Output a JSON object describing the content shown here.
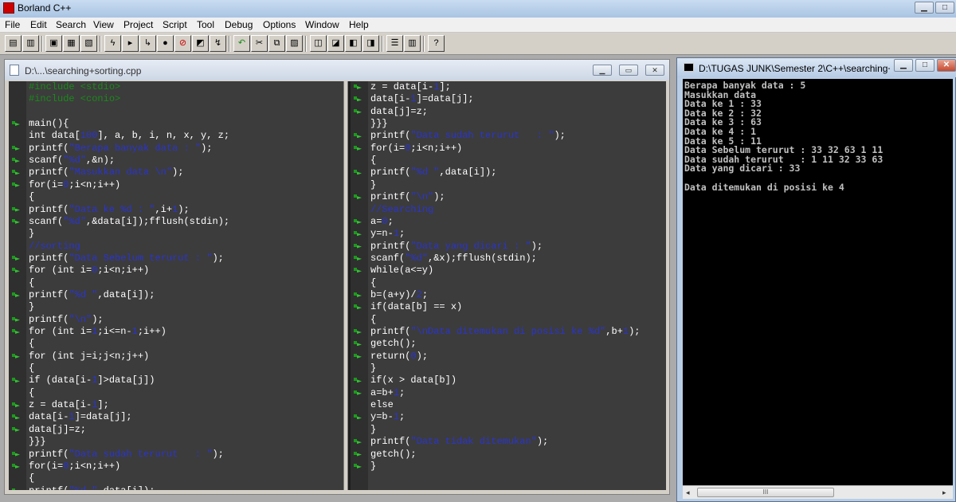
{
  "app": {
    "title": "Borland C++"
  },
  "menu": [
    "File",
    "Edit",
    "Search",
    "View",
    "Project",
    "Script",
    "Tool",
    "Debug",
    "Options",
    "Window",
    "Help"
  ],
  "editor": {
    "title": "D:\\...\\searching+sorting.cpp"
  },
  "console": {
    "title": "D:\\TUGAS JUNK\\Semester 2\\C++\\searching+...",
    "lines": [
      "Berapa banyak data : 5",
      "Masukkan data",
      "Data ke 1 : 33",
      "Data ke 2 : 32",
      "Data ke 3 : 63",
      "Data ke 4 : 1",
      "Data ke 5 : 11",
      "Data Sebelum terurut : 33 32 63 1 11",
      "Data sudah terurut   : 1 11 32 33 63",
      "Data yang dicari : 33",
      "",
      "Data ditemukan di posisi ke 4"
    ],
    "scroll_grip": "III"
  },
  "code_left": [
    {
      "m": false,
      "t": [
        [
          "p",
          "#include <stdio>"
        ]
      ]
    },
    {
      "m": false,
      "t": [
        [
          "p",
          "#include <conio>"
        ]
      ]
    },
    {
      "m": false,
      "t": []
    },
    {
      "m": true,
      "t": [
        [
          "t",
          "main(){"
        ]
      ]
    },
    {
      "m": false,
      "t": [
        [
          "t",
          "int data["
        ],
        [
          "n",
          "100"
        ],
        [
          "t",
          "], a, b, i, n, x, y, z;"
        ]
      ]
    },
    {
      "m": true,
      "t": [
        [
          "t",
          "printf("
        ],
        [
          "s",
          "\"Berapa banyak data : \""
        ],
        [
          "t",
          ");"
        ]
      ]
    },
    {
      "m": true,
      "t": [
        [
          "t",
          "scanf("
        ],
        [
          "s",
          "\"%d\""
        ],
        [
          "t",
          ",&n);"
        ]
      ]
    },
    {
      "m": true,
      "t": [
        [
          "t",
          "printf("
        ],
        [
          "s",
          "\"Masukkan data \\n\""
        ],
        [
          "t",
          ");"
        ]
      ]
    },
    {
      "m": true,
      "t": [
        [
          "t",
          "for(i="
        ],
        [
          "n",
          "0"
        ],
        [
          "t",
          ";i<n;i++)"
        ]
      ]
    },
    {
      "m": false,
      "t": [
        [
          "t",
          "{"
        ]
      ]
    },
    {
      "m": true,
      "t": [
        [
          "t",
          "printf("
        ],
        [
          "s",
          "\"Data ke %d : \""
        ],
        [
          "t",
          ",i+"
        ],
        [
          "n",
          "1"
        ],
        [
          "t",
          ");"
        ]
      ]
    },
    {
      "m": true,
      "t": [
        [
          "t",
          "scanf("
        ],
        [
          "s",
          "\"%d\""
        ],
        [
          "t",
          ",&data[i]);fflush(stdin);"
        ]
      ]
    },
    {
      "m": false,
      "t": [
        [
          "t",
          "}"
        ]
      ]
    },
    {
      "m": false,
      "t": [
        [
          "c",
          "//sorting"
        ]
      ]
    },
    {
      "m": true,
      "t": [
        [
          "t",
          "printf("
        ],
        [
          "s",
          "\"Data Sebelum terurut : \""
        ],
        [
          "t",
          ");"
        ]
      ]
    },
    {
      "m": true,
      "t": [
        [
          "t",
          "for (int i="
        ],
        [
          "n",
          "0"
        ],
        [
          "t",
          ";i<n;i++)"
        ]
      ]
    },
    {
      "m": false,
      "t": [
        [
          "t",
          "{"
        ]
      ]
    },
    {
      "m": true,
      "t": [
        [
          "t",
          "printf("
        ],
        [
          "s",
          "\"%d \""
        ],
        [
          "t",
          ",data[i]);"
        ]
      ]
    },
    {
      "m": false,
      "t": [
        [
          "t",
          "}"
        ]
      ]
    },
    {
      "m": true,
      "t": [
        [
          "t",
          "printf("
        ],
        [
          "s",
          "\"\\n\""
        ],
        [
          "t",
          ");"
        ]
      ]
    },
    {
      "m": true,
      "t": [
        [
          "t",
          "for (int i="
        ],
        [
          "n",
          "1"
        ],
        [
          "t",
          ";i<=n-"
        ],
        [
          "n",
          "1"
        ],
        [
          "t",
          ";i++)"
        ]
      ]
    },
    {
      "m": false,
      "t": [
        [
          "t",
          "{"
        ]
      ]
    },
    {
      "m": true,
      "t": [
        [
          "t",
          "for (int j=i;j<n;j++)"
        ]
      ]
    },
    {
      "m": false,
      "t": [
        [
          "t",
          "{"
        ]
      ]
    },
    {
      "m": true,
      "t": [
        [
          "t",
          "if (data[i-"
        ],
        [
          "n",
          "1"
        ],
        [
          "t",
          "]>data[j])"
        ]
      ]
    },
    {
      "m": false,
      "t": [
        [
          "t",
          "{"
        ]
      ]
    },
    {
      "m": true,
      "t": [
        [
          "t",
          "z = data[i-"
        ],
        [
          "n",
          "1"
        ],
        [
          "t",
          "];"
        ]
      ]
    },
    {
      "m": true,
      "t": [
        [
          "t",
          "data[i-"
        ],
        [
          "n",
          "1"
        ],
        [
          "t",
          "]=data[j];"
        ]
      ]
    },
    {
      "m": true,
      "t": [
        [
          "t",
          "data[j]=z;"
        ]
      ]
    },
    {
      "m": false,
      "t": [
        [
          "t",
          "}}}"
        ]
      ]
    },
    {
      "m": true,
      "t": [
        [
          "t",
          "printf("
        ],
        [
          "s",
          "\"Data sudah terurut   : \""
        ],
        [
          "t",
          ");"
        ]
      ]
    },
    {
      "m": true,
      "t": [
        [
          "t",
          "for(i="
        ],
        [
          "n",
          "0"
        ],
        [
          "t",
          ";i<n;i++)"
        ]
      ]
    },
    {
      "m": false,
      "t": [
        [
          "t",
          "{"
        ]
      ]
    },
    {
      "m": true,
      "t": [
        [
          "t",
          "printf("
        ],
        [
          "s",
          "\"%d \""
        ],
        [
          "t",
          ",data[i]);"
        ]
      ]
    }
  ],
  "code_right": [
    {
      "m": true,
      "t": [
        [
          "t",
          "z = data[i-"
        ],
        [
          "n",
          "1"
        ],
        [
          "t",
          "];"
        ]
      ]
    },
    {
      "m": true,
      "t": [
        [
          "t",
          "data[i-"
        ],
        [
          "n",
          "1"
        ],
        [
          "t",
          "]=data[j];"
        ]
      ]
    },
    {
      "m": true,
      "t": [
        [
          "t",
          "data[j]=z;"
        ]
      ]
    },
    {
      "m": false,
      "t": [
        [
          "t",
          "}}}"
        ]
      ]
    },
    {
      "m": true,
      "t": [
        [
          "t",
          "printf("
        ],
        [
          "s",
          "\"Data sudah terurut   : \""
        ],
        [
          "t",
          ");"
        ]
      ]
    },
    {
      "m": true,
      "t": [
        [
          "t",
          "for(i="
        ],
        [
          "n",
          "0"
        ],
        [
          "t",
          ";i<n;i++)"
        ]
      ]
    },
    {
      "m": false,
      "t": [
        [
          "t",
          "{"
        ]
      ]
    },
    {
      "m": true,
      "t": [
        [
          "t",
          "printf("
        ],
        [
          "s",
          "\"%d \""
        ],
        [
          "t",
          ",data[i]);"
        ]
      ]
    },
    {
      "m": false,
      "t": [
        [
          "t",
          "}"
        ]
      ]
    },
    {
      "m": true,
      "t": [
        [
          "t",
          "printf("
        ],
        [
          "s",
          "\"\\n\""
        ],
        [
          "t",
          ");"
        ]
      ]
    },
    {
      "m": false,
      "t": [
        [
          "c",
          "//Searching"
        ]
      ]
    },
    {
      "m": true,
      "t": [
        [
          "t",
          "a="
        ],
        [
          "n",
          "0"
        ],
        [
          "t",
          ";"
        ]
      ]
    },
    {
      "m": true,
      "t": [
        [
          "t",
          "y=n-"
        ],
        [
          "n",
          "1"
        ],
        [
          "t",
          ";"
        ]
      ]
    },
    {
      "m": true,
      "t": [
        [
          "t",
          "printf("
        ],
        [
          "s",
          "\"Data yang dicari : \""
        ],
        [
          "t",
          ");"
        ]
      ]
    },
    {
      "m": true,
      "t": [
        [
          "t",
          "scanf("
        ],
        [
          "s",
          "\"%d\""
        ],
        [
          "t",
          ",&x);fflush(stdin);"
        ]
      ]
    },
    {
      "m": true,
      "t": [
        [
          "t",
          "while(a<=y)"
        ]
      ]
    },
    {
      "m": false,
      "t": [
        [
          "t",
          "{"
        ]
      ]
    },
    {
      "m": true,
      "t": [
        [
          "t",
          "b=(a+y)/"
        ],
        [
          "n",
          "2"
        ],
        [
          "t",
          ";"
        ]
      ]
    },
    {
      "m": true,
      "t": [
        [
          "t",
          "if(data[b] == x)"
        ]
      ]
    },
    {
      "m": false,
      "t": [
        [
          "t",
          "{"
        ]
      ]
    },
    {
      "m": true,
      "t": [
        [
          "t",
          "printf("
        ],
        [
          "s",
          "\"\\nData ditemukan di posisi ke %d\""
        ],
        [
          "t",
          ",b+"
        ],
        [
          "n",
          "1"
        ],
        [
          "t",
          ");"
        ]
      ]
    },
    {
      "m": true,
      "t": [
        [
          "t",
          "getch();"
        ]
      ]
    },
    {
      "m": true,
      "t": [
        [
          "t",
          "return("
        ],
        [
          "n",
          "0"
        ],
        [
          "t",
          ");"
        ]
      ]
    },
    {
      "m": false,
      "t": [
        [
          "t",
          "}"
        ]
      ]
    },
    {
      "m": true,
      "t": [
        [
          "t",
          "if(x > data[b])"
        ]
      ]
    },
    {
      "m": true,
      "t": [
        [
          "t",
          "a=b+"
        ],
        [
          "n",
          "1"
        ],
        [
          "t",
          ";"
        ]
      ]
    },
    {
      "m": false,
      "t": [
        [
          "t",
          "else"
        ]
      ]
    },
    {
      "m": true,
      "t": [
        [
          "t",
          "y=b-"
        ],
        [
          "n",
          "1"
        ],
        [
          "t",
          ";"
        ]
      ]
    },
    {
      "m": false,
      "t": [
        [
          "t",
          "}"
        ]
      ]
    },
    {
      "m": true,
      "t": [
        [
          "t",
          "printf("
        ],
        [
          "s",
          "\"Data tidak ditemukan\""
        ],
        [
          "t",
          ");"
        ]
      ]
    },
    {
      "m": true,
      "t": [
        [
          "t",
          "getch();"
        ]
      ]
    },
    {
      "m": true,
      "t": [
        [
          "t",
          "}"
        ]
      ]
    }
  ],
  "colors": {
    "editor_bg": "#3c3c3c",
    "code_text": "#ffffff",
    "string": "#2a34d0",
    "preprocessor": "#1a8a1a",
    "console_bg": "#000000"
  }
}
